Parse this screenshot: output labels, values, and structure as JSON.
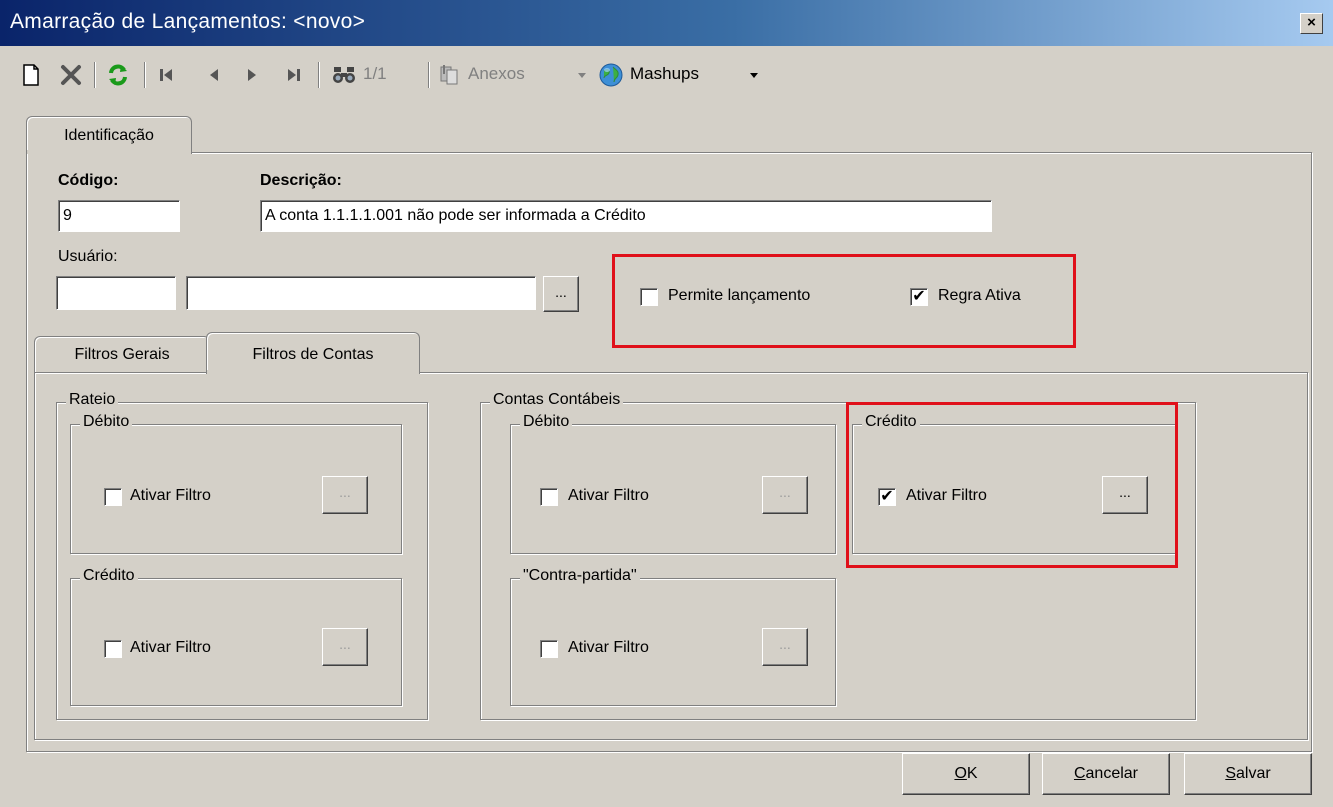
{
  "window": {
    "title": "Amarração de Lançamentos: <novo>",
    "close_label": "×"
  },
  "toolbar": {
    "record_position": "1/1",
    "anexos_label": "Anexos",
    "mashups_label": "Mashups"
  },
  "tabs_main": [
    {
      "label": "Identificação",
      "active": true
    }
  ],
  "form": {
    "codigo_label": "Código:",
    "codigo_value": "9",
    "descricao_label": "Descrição:",
    "descricao_value": "A conta 1.1.1.1.001 não pode ser informada a Crédito",
    "usuario_label": "Usuário:",
    "usuario_code_value": "",
    "usuario_name_value": "",
    "lookup_label": "..."
  },
  "options": {
    "permite_lancamento": {
      "label": "Permite lançamento",
      "checked": false
    },
    "regra_ativa": {
      "label": "Regra Ativa",
      "checked": true
    }
  },
  "tabs_filters": [
    {
      "label": "Filtros Gerais",
      "active": false
    },
    {
      "label": "Filtros de Contas",
      "active": true
    }
  ],
  "rateio": {
    "title": "Rateio",
    "debito": {
      "title": "Débito",
      "filter_label": "Ativar Filtro",
      "checked": false
    },
    "credito": {
      "title": "Crédito",
      "filter_label": "Ativar Filtro",
      "checked": false
    }
  },
  "contas_contabeis": {
    "title": "Contas Contábeis",
    "debito": {
      "title": "Débito",
      "filter_label": "Ativar Filtro",
      "checked": false
    },
    "credito": {
      "title": "Crédito",
      "filter_label": "Ativar Filtro",
      "checked": true
    },
    "contrapartida": {
      "title": "\"Contra-partida\"",
      "filter_label": "Ativar Filtro",
      "checked": false
    }
  },
  "buttons": {
    "ok": {
      "underlined": "O",
      "rest": "K"
    },
    "cancelar": {
      "underlined": "C",
      "rest": "ancelar"
    },
    "salvar": {
      "underlined": "S",
      "rest": "alvar"
    }
  },
  "colors": {
    "title_start": "#0a246a",
    "title_end": "#a6caf0",
    "highlight": "#e0101a",
    "face": "#d4d0c8"
  }
}
